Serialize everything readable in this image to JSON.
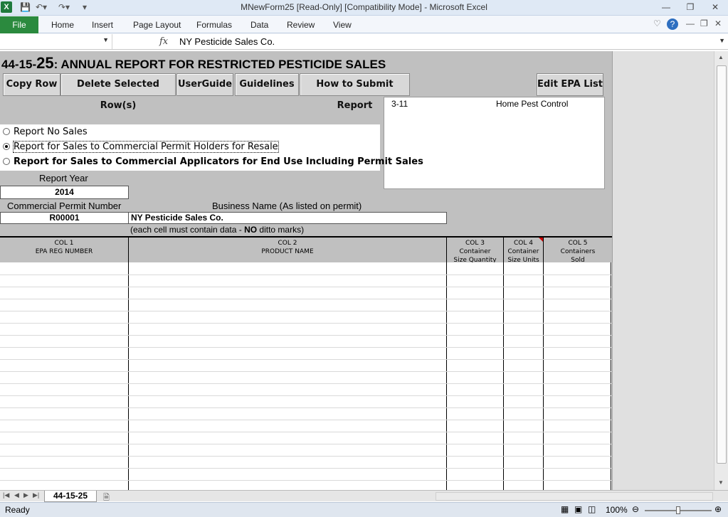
{
  "window": {
    "title": "MNewForm25  [Read-Only]  [Compatibility Mode]  -  Microsoft Excel",
    "app_icon": "X"
  },
  "ribbon": {
    "file": "File",
    "tabs": [
      "Home",
      "Insert",
      "Page Layout",
      "Formulas",
      "Data",
      "Review",
      "View"
    ]
  },
  "formula_bar": {
    "fx": "fx",
    "value": "NY Pesticide Sales Co."
  },
  "form": {
    "title_prefix": "44-15-",
    "title_number": "25",
    "title_rest": ": ANNUAL REPORT FOR RESTRICTED PESTICIDE SALES",
    "buttons": [
      "Copy Row",
      "Delete Selected Row(s)",
      "UserGuide",
      "Guidelines",
      "How to Submit Report"
    ],
    "edit_epa_button": "Edit EPA List",
    "listbox": {
      "code": "3-11",
      "name": "Home Pest Control"
    },
    "radios": [
      {
        "label": "Report No Sales",
        "checked": false
      },
      {
        "label": "Report for Sales to Commercial Permit Holders for Resale",
        "checked": true
      },
      {
        "label": "Report for Sales to Commercial Applicators for End Use Including Permit Sales",
        "checked": false
      }
    ],
    "report_year_label": "Report Year",
    "report_year": "2014",
    "permit_label": "Commercial Permit Number",
    "permit_number": "R00001",
    "business_label": "Business Name (As listed on permit)",
    "business_name": "NY Pesticide Sales Co.",
    "note_pre": "(each cell must contain data - ",
    "note_bold": "NO",
    "note_post": " ditto marks)"
  },
  "table": {
    "columns": [
      {
        "l1": "COL 1",
        "l2": "EPA REG NUMBER",
        "l3": ""
      },
      {
        "l1": "COL 2",
        "l2": "PRODUCT NAME",
        "l3": ""
      },
      {
        "l1": "COL 3",
        "l2": "Container",
        "l3": "Size Quantity"
      },
      {
        "l1": "COL 4",
        "l2": "Container",
        "l3": "Size Units"
      },
      {
        "l1": "COL 5",
        "l2": "Containers",
        "l3": "Sold"
      }
    ]
  },
  "sheet_tab": "44-15-25",
  "status": {
    "ready": "Ready",
    "zoom": "100%"
  }
}
